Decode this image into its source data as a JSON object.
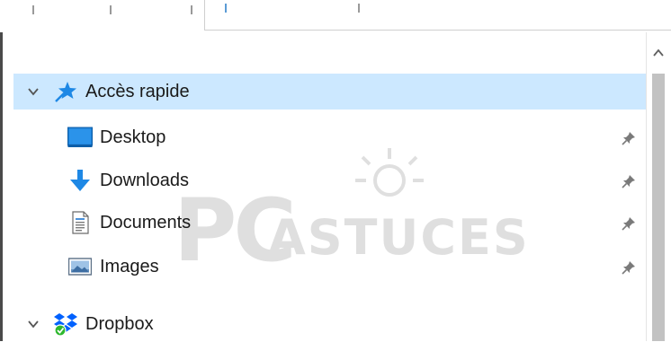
{
  "navigation": {
    "quick_access": {
      "label": "Accès rapide",
      "expanded": true,
      "selected": true,
      "icon": "blue-star-pin-icon",
      "items": [
        {
          "label": "Desktop",
          "icon": "desktop-folder-icon",
          "pinned": true
        },
        {
          "label": "Downloads",
          "icon": "download-arrow-icon",
          "pinned": true
        },
        {
          "label": "Documents",
          "icon": "document-icon",
          "pinned": true
        },
        {
          "label": "Images",
          "icon": "pictures-icon",
          "pinned": true
        }
      ]
    },
    "dropbox": {
      "label": "Dropbox",
      "expanded": true,
      "icon": "dropbox-icon"
    }
  },
  "watermark": {
    "big": "PC",
    "small": "ASTUCES"
  },
  "colors": {
    "selection": "#cce8ff",
    "accent_blue": "#1e88e5",
    "dropbox_blue": "#0061fe",
    "sync_green": "#2eb82e"
  }
}
